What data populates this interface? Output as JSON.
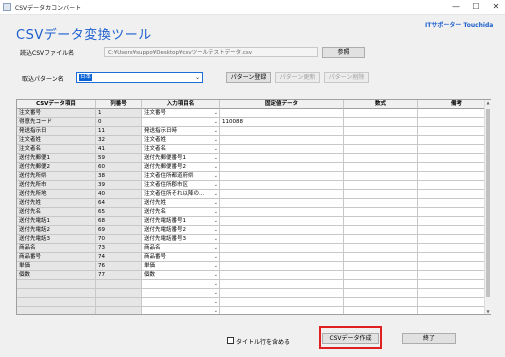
{
  "window": {
    "title": "CSVデータカコンバート",
    "minimize": "—",
    "maximize": "☐",
    "close": "✕"
  },
  "header": {
    "title": "CSVデータ変換ツール",
    "brand": "ITサポーター Touchida"
  },
  "file": {
    "label": "読込CSVファイル名",
    "path": "C:¥Users¥suppo¥Desktop¥csvツールテストデータ.csv",
    "browse_label": "参照"
  },
  "pattern": {
    "label": "取込パターン名",
    "selected": "日本",
    "register_label": "パターン登録",
    "update_label": "パターン更新",
    "delete_label": "パターン削除"
  },
  "table": {
    "columns": [
      "CSVデータ項目",
      "列番号",
      "入力項目名",
      "固定値データ",
      "数式",
      "備考"
    ],
    "rows": [
      [
        "注文番号",
        "1",
        "注文番号",
        "",
        "",
        ""
      ],
      [
        "得意先コード",
        "0",
        "",
        "110088",
        "",
        ""
      ],
      [
        "発送指示日",
        "11",
        "発送指示日時",
        "",
        "",
        ""
      ],
      [
        "注文者姓",
        "32",
        "注文者姓",
        "",
        "",
        ""
      ],
      [
        "注文者名",
        "41",
        "注文者名",
        "",
        "",
        ""
      ],
      [
        "送付先郵便1",
        "59",
        "送付先郵便番号1",
        "",
        "",
        ""
      ],
      [
        "送付先郵便2",
        "60",
        "送付先郵便番号2",
        "",
        "",
        ""
      ],
      [
        "送付先所県",
        "38",
        "注文者住所都道府県",
        "",
        "",
        ""
      ],
      [
        "送付先所市",
        "39",
        "注文者住所郡市区",
        "",
        "",
        ""
      ],
      [
        "送付先所地",
        "40",
        "注文者住所それ以降の...",
        "",
        "",
        ""
      ],
      [
        "送付先姓",
        "64",
        "送付先姓",
        "",
        "",
        ""
      ],
      [
        "送付先名",
        "65",
        "送付先名",
        "",
        "",
        ""
      ],
      [
        "送付先電話1",
        "68",
        "送付先電話番号1",
        "",
        "",
        ""
      ],
      [
        "送付先電話2",
        "69",
        "送付先電話番号2",
        "",
        "",
        ""
      ],
      [
        "送付先電話3",
        "70",
        "送付先電話番号3",
        "",
        "",
        ""
      ],
      [
        "商品名",
        "73",
        "商品名",
        "",
        "",
        ""
      ],
      [
        "商品番号",
        "74",
        "商品番号",
        "",
        "",
        ""
      ],
      [
        "単価",
        "76",
        "単価",
        "",
        "",
        ""
      ],
      [
        "個数",
        "77",
        "個数",
        "",
        "",
        ""
      ],
      [
        "",
        "",
        "",
        "",
        "",
        ""
      ],
      [
        "",
        "",
        "",
        "",
        "",
        ""
      ],
      [
        "",
        "",
        "",
        "",
        "",
        ""
      ],
      [
        "",
        "",
        "",
        "",
        "",
        ""
      ]
    ]
  },
  "footer": {
    "include_title_label": "タイトル行を含める",
    "create_label": "CSVデータ作成",
    "exit_label": "終了"
  },
  "colors": {
    "accent": "#1c5fcf",
    "highlight_border": "#e02020"
  }
}
